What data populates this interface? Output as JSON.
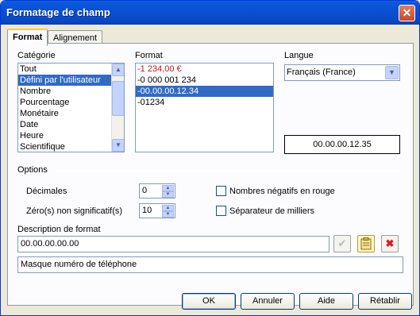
{
  "window": {
    "title": "Formatage de champ",
    "close_glyph": "✕"
  },
  "tabs": [
    {
      "label": "Format"
    },
    {
      "label": "Alignement"
    }
  ],
  "category": {
    "label": "Catégorie",
    "items": [
      "Tout",
      "Défini par l'utilisateur",
      "Nombre",
      "Pourcentage",
      "Monétaire",
      "Date",
      "Heure",
      "Scientifique"
    ],
    "selected_index": 1
  },
  "format": {
    "label": "Format",
    "items": [
      "-1 234,00 €",
      "-0 000 001 234",
      "-00.00.00.12.34",
      "-01234"
    ],
    "selected_index": 2,
    "negative_color": "#c0161b"
  },
  "language": {
    "label": "Langue",
    "value": "Français (France)"
  },
  "preview": {
    "value": "00.00.00.12.35"
  },
  "options": {
    "label": "Options",
    "decimals": {
      "label": "Décimales",
      "value": "0"
    },
    "leading_zeros": {
      "label": "Zéro(s) non significatif(s)",
      "value": "10"
    },
    "negative_red": {
      "label": "Nombres négatifs en rouge",
      "checked": false
    },
    "thousands_sep": {
      "label": "Séparateur de milliers",
      "checked": false
    }
  },
  "format_code": {
    "label": "Description de format",
    "value": "00.00.00.00.00",
    "comment": "Masque numéro de téléphone"
  },
  "buttons": {
    "ok": "OK",
    "cancel": "Annuler",
    "help": "Aide",
    "reset": "Rétablir"
  },
  "colors": {
    "accent": "#316ac5",
    "titlebar": "#0a4fd0",
    "delete": "#d81d1d"
  }
}
